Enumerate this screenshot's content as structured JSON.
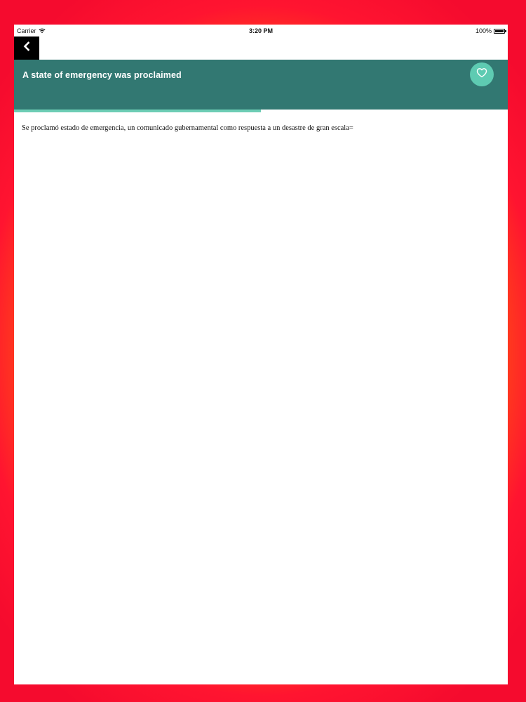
{
  "status_bar": {
    "carrier": "Carrier",
    "time": "3:20 PM",
    "battery": "100%"
  },
  "header": {
    "title": "A state of emergency was proclaimed"
  },
  "progress": {
    "fraction": 0.5
  },
  "content": {
    "text": "Se proclamó estado de emergencia, un comunicado gubernamental como respuesta a un desastre de gran escala="
  },
  "icons": {
    "back": "chevron-left-icon",
    "favorite": "heart-outline-icon",
    "wifi": "wifi-icon",
    "battery": "battery-icon"
  },
  "colors": {
    "header_bg": "#327872",
    "accent": "#5ecbb2",
    "progress": "#6dcdb5",
    "back_button_bg": "#000000"
  }
}
